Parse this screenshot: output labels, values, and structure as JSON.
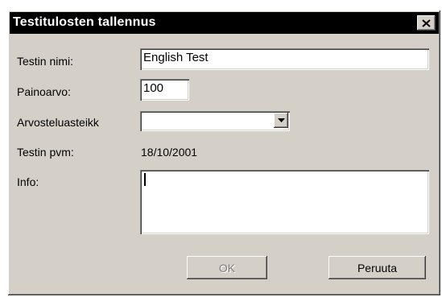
{
  "dialog": {
    "title": "Testitulosten tallennus"
  },
  "form": {
    "name_label": "Testin nimi:",
    "name_value": "English Test",
    "weight_label": "Painoarvo:",
    "weight_value": "100",
    "scale_label": "Arvosteluasteikk",
    "scale_value": "",
    "date_label": "Testin pvm:",
    "date_value": "18/10/2001",
    "info_label": "Info:",
    "info_value": ""
  },
  "buttons": {
    "ok_label": "OK",
    "cancel_label": "Peruuta"
  },
  "icons": {
    "close": "close-icon",
    "dropdown": "chevron-down-icon"
  }
}
